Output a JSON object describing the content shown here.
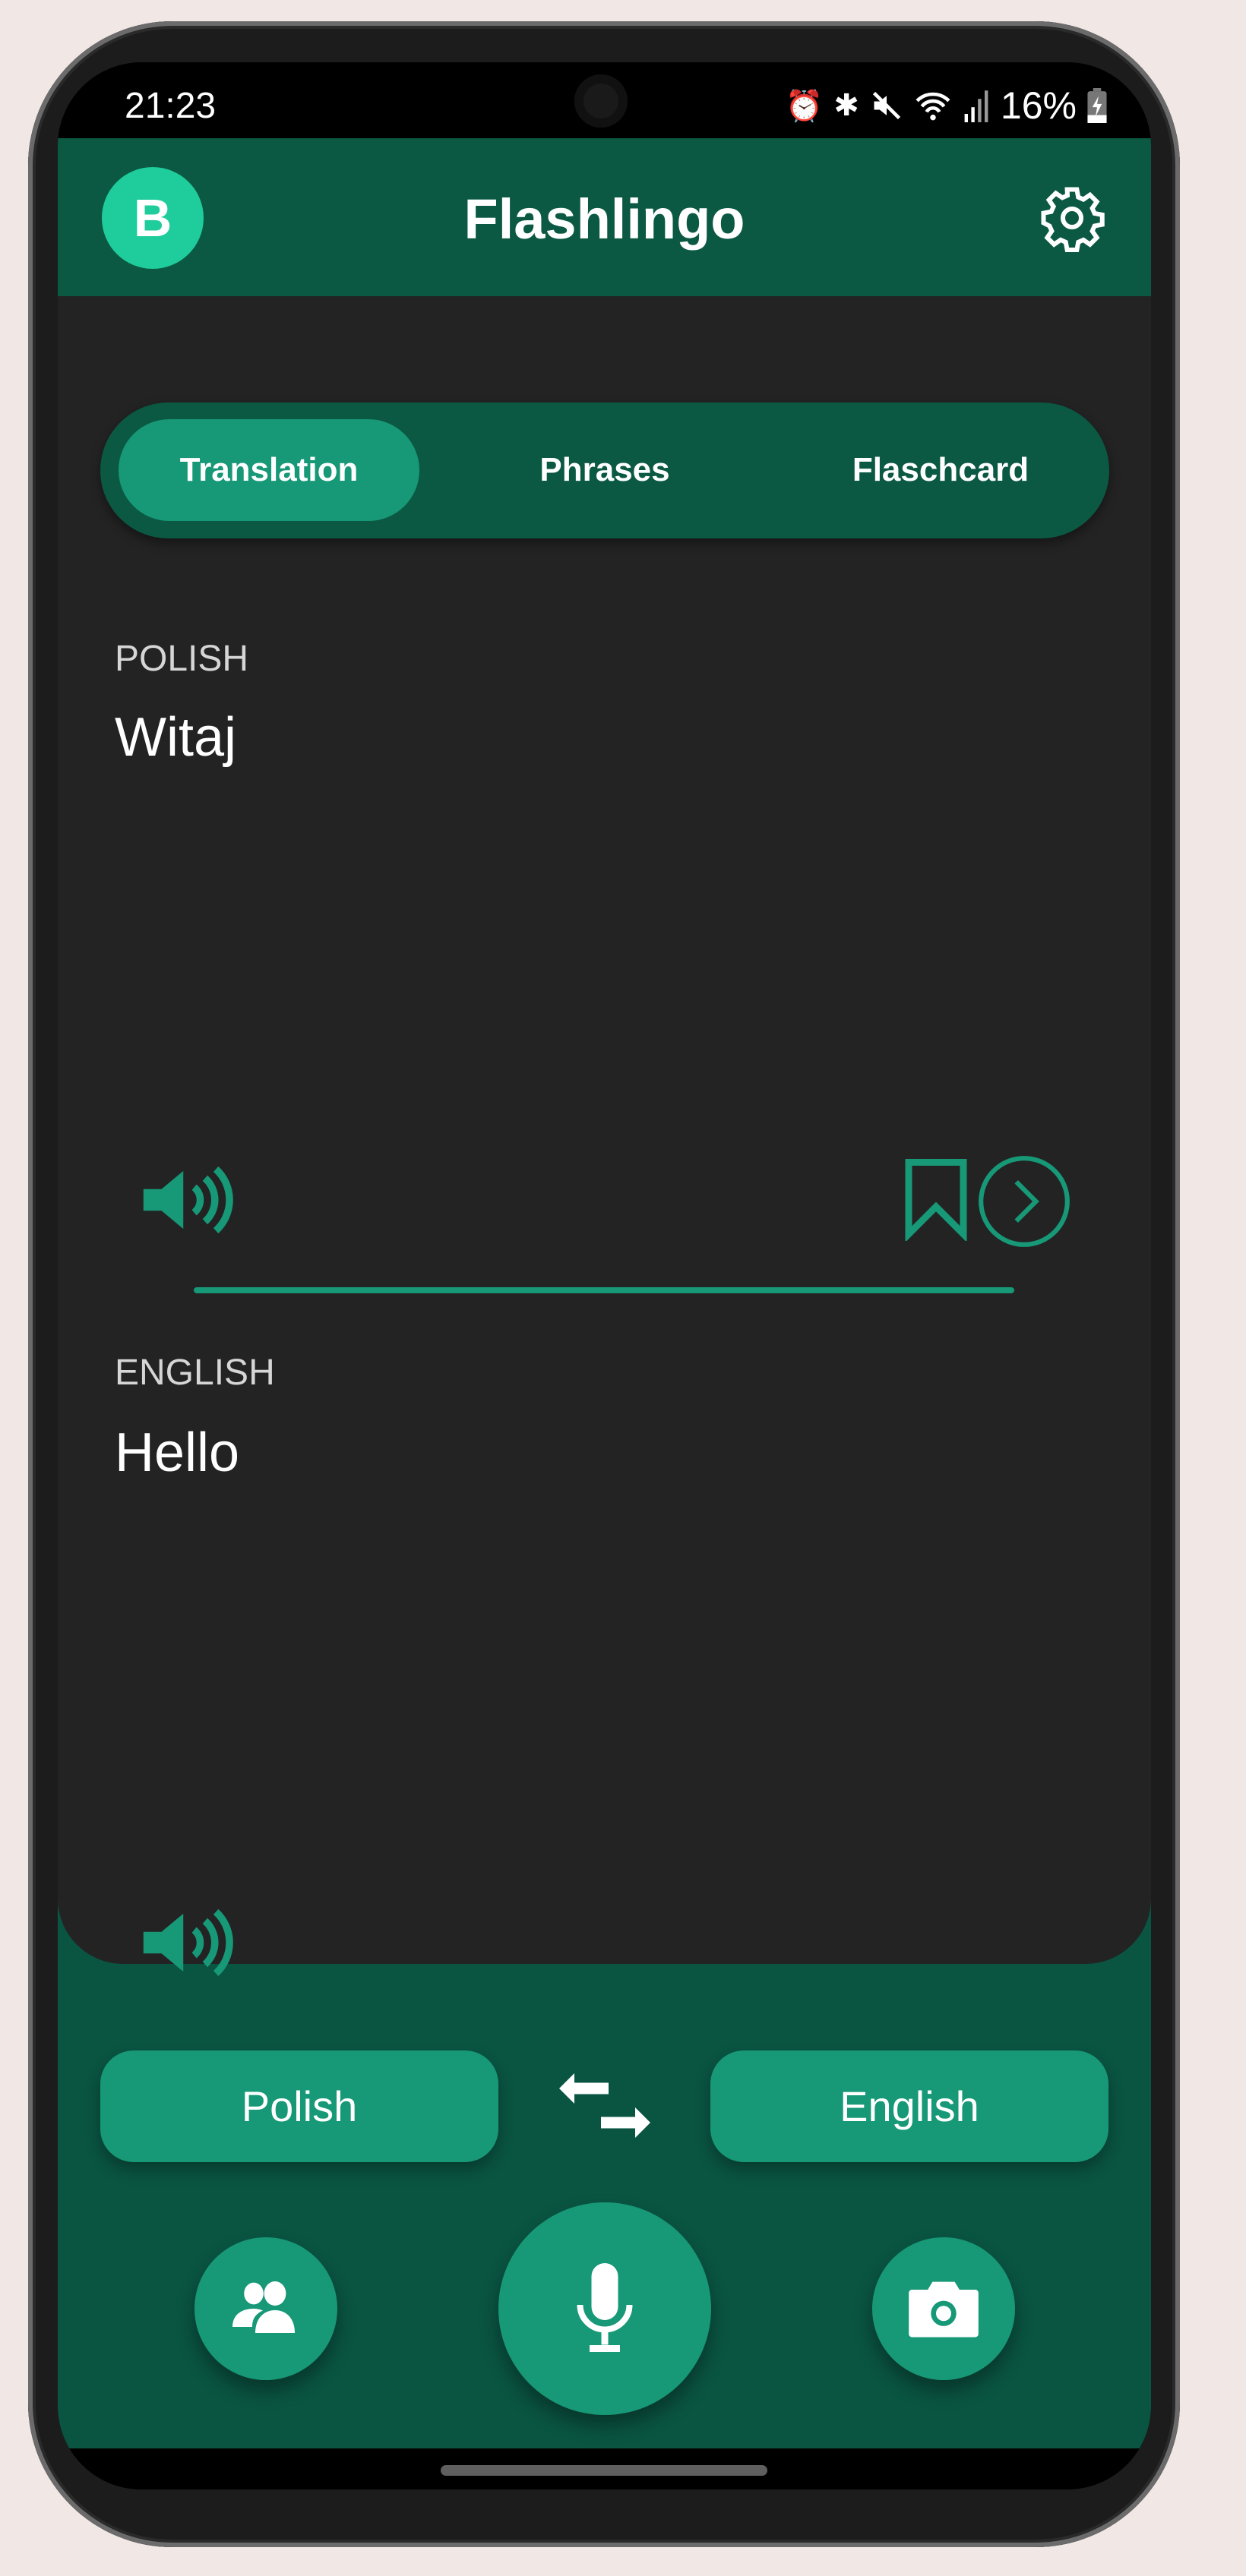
{
  "status_bar": {
    "time": "21:23",
    "battery": "16%",
    "icons": [
      "alarm-icon",
      "bluetooth-icon",
      "mute-icon",
      "wifi-icon",
      "signal-icon",
      "battery-charging-icon"
    ]
  },
  "header": {
    "avatar_letter": "B",
    "title": "Flashlingo",
    "settings_icon": "gear-icon"
  },
  "tabs": [
    {
      "label": "Translation",
      "active": true
    },
    {
      "label": "Phrases",
      "active": false
    },
    {
      "label": "Flaschcard",
      "active": false
    }
  ],
  "source": {
    "language_label": "POLISH",
    "text": "Witaj"
  },
  "target": {
    "language_label": "ENGLISH",
    "text": "Hello"
  },
  "language_selector": {
    "from": "Polish",
    "to": "English"
  },
  "actions": [
    "conversation-icon",
    "microphone-icon",
    "camera-icon"
  ],
  "colors": {
    "header": "#0b5943",
    "accent": "#179877",
    "avatar": "#1fcc9c",
    "surface": "#232323",
    "bottom": "#0a5442"
  }
}
